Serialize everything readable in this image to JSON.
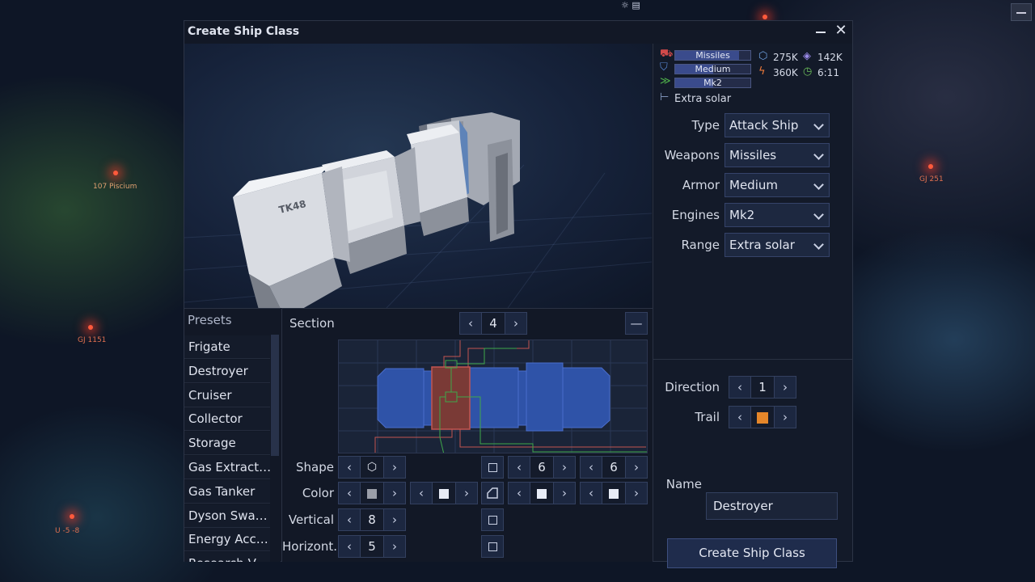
{
  "window": {
    "title": "Create Ship Class"
  },
  "map": {
    "stars": [
      "107 Piscium",
      "GJ 251",
      "GJ 1151",
      "U -5 -8"
    ]
  },
  "hull_text": "TK48",
  "stats": {
    "weapons_badge": "Missiles",
    "armor_badge": "Medium",
    "engine_badge": "Mk2",
    "range_text": "Extra solar",
    "resource_1": "275K",
    "resource_2": "142K",
    "energy": "360K",
    "time": "6:11",
    "weapons_fill": 0.85,
    "armor_fill": 0.5,
    "engine_fill": 0.5
  },
  "fields": {
    "type": {
      "label": "Type",
      "value": "Attack Ship"
    },
    "weapons": {
      "label": "Weapons",
      "value": "Missiles"
    },
    "armor": {
      "label": "Armor",
      "value": "Medium"
    },
    "engines": {
      "label": "Engines",
      "value": "Mk2"
    },
    "range": {
      "label": "Range",
      "value": "Extra solar"
    }
  },
  "presets": {
    "title": "Presets",
    "items": [
      "Frigate",
      "Destroyer",
      "Cruiser",
      "Collector",
      "Storage",
      "Gas Extract…",
      "Gas Tanker",
      "Dyson Swa…",
      "Energy Acc…",
      "Research V…"
    ]
  },
  "section": {
    "label": "Section",
    "value": "4"
  },
  "shape": {
    "label": "Shape",
    "val1": "6",
    "val2": "6"
  },
  "color": {
    "label": "Color",
    "colors": [
      "#9a9ea8",
      "#e8ecf6",
      "#e8ecf6",
      "#e8ecf6"
    ]
  },
  "vertical": {
    "label": "Vertical",
    "value": "8"
  },
  "horizontal": {
    "label": "Horizont.",
    "value": "5"
  },
  "direction": {
    "label": "Direction",
    "value": "1"
  },
  "trail": {
    "label": "Trail",
    "color": "#e5862a"
  },
  "name": {
    "label": "Name",
    "value": "Destroyer"
  },
  "create_button": "Create Ship Class",
  "icons": {
    "prev": "‹",
    "next": "›",
    "close": "✕",
    "minus": "—"
  }
}
